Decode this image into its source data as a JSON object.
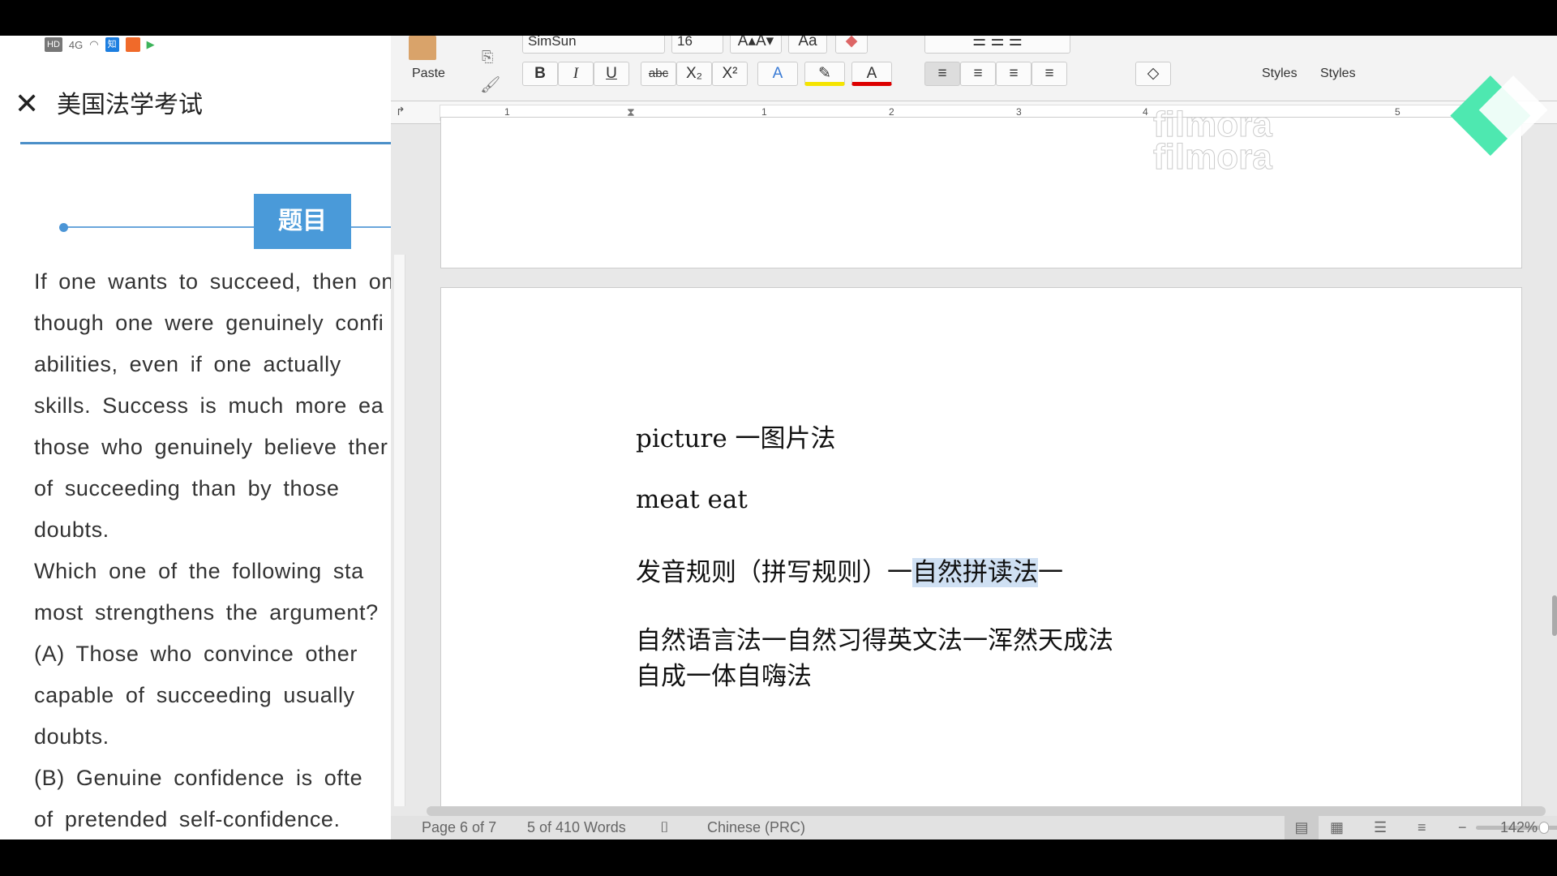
{
  "phone": {
    "status_icons": [
      "HD",
      "4G",
      "wifi-icon",
      "知",
      "app-icon",
      "play-icon"
    ],
    "title": "美国法学考试",
    "step_label": "题目",
    "question_lines": [
      "If one wants to succeed, then one",
      "though one were genuinely confi",
      "abilities,  even  if  one  actually",
      "skills. Success is much more ea",
      "those who genuinely believe ther",
      "of  succeeding  than  by  those",
      "doubts.",
      "Which one of the following sta",
      "most strengthens the argument?",
      "(A)  Those  who  convince  other",
      "capable  of  succeeding  usually",
      "doubts.",
      "(B) Genuine confidence is ofte",
      "of pretended self-confidence."
    ]
  },
  "word": {
    "ribbon": {
      "font_name": "SimSun",
      "font_size": "16",
      "paste_label": "Paste",
      "bold": "B",
      "italic": "I",
      "underline": "U",
      "strike": "abc",
      "subscript": "X₂",
      "superscript": "X²",
      "styles_label": "Styles",
      "styles_pane_label": "Styles"
    },
    "ruler_numbers": [
      "1",
      "1",
      "2",
      "3",
      "4",
      "5"
    ],
    "document_lines": {
      "l1": "picture 一图片法",
      "l2": "meat eat",
      "l3a": "发音规则（拼写规则）一",
      "l3b": "自然拼读法",
      "l3c": "一",
      "l4": "自然语言法一自然习得英文法一浑然天成法",
      "l5": "自成一体自嗨法"
    },
    "status": {
      "page": "Page 6 of 7",
      "words": "5 of 410 Words",
      "language": "Chinese (PRC)",
      "zoom": "142%",
      "zoom_level_percent": 142
    },
    "watermark": "filmora"
  }
}
